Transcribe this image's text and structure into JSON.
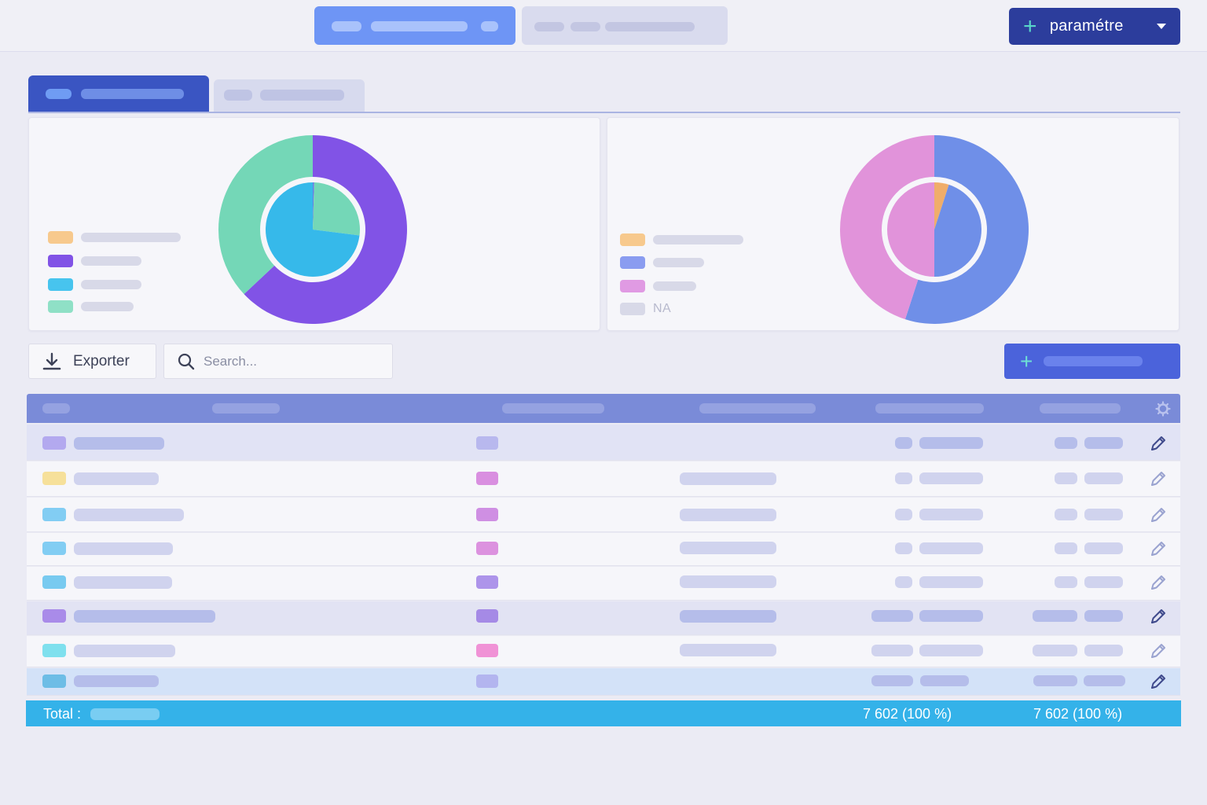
{
  "header": {
    "settings_button_label": "paramétre"
  },
  "charts": [
    {
      "type": "donut",
      "legend_swatch_colors": [
        "#f7c98d",
        "#8153e6",
        "#47c4ee",
        "#8fe0c6"
      ],
      "outer_ring": [
        {
          "color": "#8153e6",
          "fraction": 0.63
        },
        {
          "color": "#74d7b7",
          "fraction": 0.37
        }
      ],
      "inner_ring": [
        {
          "color": "#6a7de2",
          "fraction": 0.005
        },
        {
          "color": "#74d7b7",
          "fraction": 0.265
        },
        {
          "color": "#36b9ea",
          "fraction": 0.73
        }
      ]
    },
    {
      "type": "donut",
      "legend_swatch_colors": [
        "#f7c98d",
        "#8a9cf0",
        "#e09ae3",
        "#d8d9e8"
      ],
      "legend_na_label": "NA",
      "outer_ring": [
        {
          "color": "#6f8fe8",
          "fraction": 0.55
        },
        {
          "color": "#e193da",
          "fraction": 0.45
        }
      ],
      "inner_ring": [
        {
          "color": "#f0ad6a",
          "fraction": 0.05
        },
        {
          "color": "#6f8fe8",
          "fraction": 0.45
        },
        {
          "color": "#e193da",
          "fraction": 0.5
        }
      ]
    }
  ],
  "toolbar": {
    "export_label": "Exporter",
    "search_placeholder": "Search..."
  },
  "table": {
    "rows": [
      {
        "swatch": "#b3a9ef",
        "tag": "#b8b8ee",
        "bg": "#e1e3f5",
        "strong": true,
        "has_col3": false
      },
      {
        "swatch": "#f6e09a",
        "tag": "#d98fe0",
        "bg": "#f6f6fa",
        "strong": false,
        "has_col3": true
      },
      {
        "swatch": "#82cdf3",
        "tag": "#cf8fe3",
        "bg": "#f6f6fa",
        "strong": false,
        "has_col3": true
      },
      {
        "swatch": "#82cdf3",
        "tag": "#dc92df",
        "bg": "#f6f6fa",
        "strong": false,
        "has_col3": true
      },
      {
        "swatch": "#78caf0",
        "tag": "#ad94ea",
        "bg": "#f6f6fa",
        "strong": false,
        "has_col3": true
      },
      {
        "swatch": "#a98be9",
        "tag": "#a58ae6",
        "bg": "#e2e3f3",
        "strong": true,
        "has_col3": true
      },
      {
        "swatch": "#7fe0ee",
        "tag": "#f092d6",
        "bg": "#f6f6fa",
        "strong": false,
        "has_col3": true
      },
      {
        "swatch": "#6dbde6",
        "tag": "#b3b5ef",
        "bg": "#d3e2f8",
        "strong": true,
        "has_col3": false
      }
    ],
    "total_label": "Total :",
    "total_col1": "7 602 (100 %)",
    "total_col2": "7 602 (100 %)"
  }
}
